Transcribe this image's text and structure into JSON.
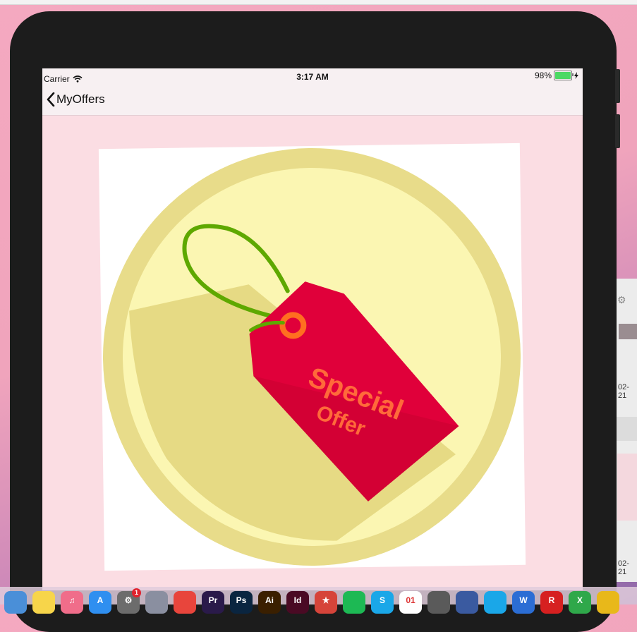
{
  "status_bar": {
    "carrier": "Carrier",
    "time": "3:17 AM",
    "battery_percent": "98%",
    "battery_level": 0.98,
    "wifi_icon": "wifi-icon",
    "charging_icon": "lightning-icon"
  },
  "nav": {
    "back_label": "MyOffers",
    "back_icon": "chevron-left-icon"
  },
  "offer": {
    "tag_line1": "Special",
    "tag_line2": "Offer",
    "colors": {
      "outer_ring": "#e8dc8a",
      "inner_circle": "#fbf6b2",
      "shadow": "#e6da84",
      "tag": "#e0003a",
      "tag_shade": "#c8002f",
      "tag_text": "#ff6a3a",
      "string": "#5ea800",
      "hole": "#ff6f20"
    }
  },
  "background_window": {
    "date_text_1": "02-21",
    "date_text_2": "02-21"
  },
  "dock": {
    "badge_count": "1",
    "apps": [
      {
        "name": "finder-icon",
        "label": "",
        "color": "#4a8fd8"
      },
      {
        "name": "notes-icon",
        "label": "",
        "color": "#f7d54a"
      },
      {
        "name": "itunes-icon",
        "label": "♫",
        "color": "#f06d8a"
      },
      {
        "name": "app-store-icon",
        "label": "A",
        "color": "#2f8ff0"
      },
      {
        "name": "system-preferences-icon",
        "label": "⚙",
        "color": "#6c6c6c"
      },
      {
        "name": "launchpad-icon",
        "label": "",
        "color": "#8a8fa0"
      },
      {
        "name": "chrome-icon",
        "label": "",
        "color": "#e8453c"
      },
      {
        "name": "premiere-icon",
        "label": "Pr",
        "color": "#2a1a4a"
      },
      {
        "name": "photoshop-icon",
        "label": "Ps",
        "color": "#0a2540"
      },
      {
        "name": "illustrator-icon",
        "label": "Ai",
        "color": "#3a1f00"
      },
      {
        "name": "indesign-icon",
        "label": "Id",
        "color": "#4a0a24"
      },
      {
        "name": "wunderlist-icon",
        "label": "★",
        "color": "#d6443a"
      },
      {
        "name": "spotify-icon",
        "label": "",
        "color": "#1db954"
      },
      {
        "name": "skype-icon",
        "label": "S",
        "color": "#1aa7e8"
      },
      {
        "name": "calendar-icon",
        "label": "01",
        "color": "#ffffff"
      },
      {
        "name": "calculator-icon",
        "label": "",
        "color": "#5a5a5a"
      },
      {
        "name": "quicktime-icon",
        "label": "",
        "color": "#3a5aa0"
      },
      {
        "name": "messenger-icon",
        "label": "",
        "color": "#1aa7e8"
      },
      {
        "name": "word-icon",
        "label": "W",
        "color": "#2b6dd4"
      },
      {
        "name": "red-app-icon",
        "label": "R",
        "color": "#d62020"
      },
      {
        "name": "green-app-icon",
        "label": "X",
        "color": "#2fa84a"
      },
      {
        "name": "yellow-app-icon",
        "label": "",
        "color": "#e8b81a"
      }
    ]
  }
}
